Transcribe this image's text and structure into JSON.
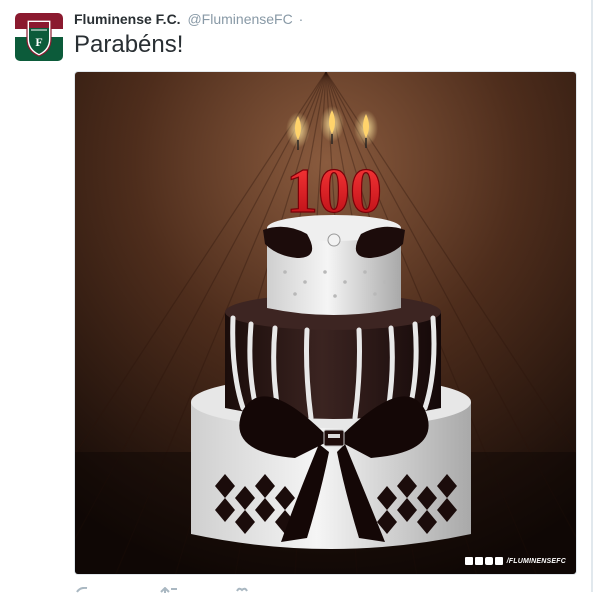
{
  "tweet": {
    "author_name": "Fluminense F.C.",
    "handle": "@FluminenseFC",
    "separator": "·",
    "text": "Parabéns!"
  },
  "media": {
    "watermark_text": "/FLUMINENSEFC",
    "candle_number": "100",
    "icons": [
      "facebook-icon",
      "twitter-icon",
      "instagram-icon",
      "youtube-icon"
    ]
  },
  "colors": {
    "club_maroon": "#8b1a2f",
    "club_green": "#0c5b3a",
    "club_white": "#ffffff",
    "candle_red": "#e0101c"
  },
  "actions": [
    "reply-icon",
    "retweet-icon",
    "like-icon"
  ]
}
